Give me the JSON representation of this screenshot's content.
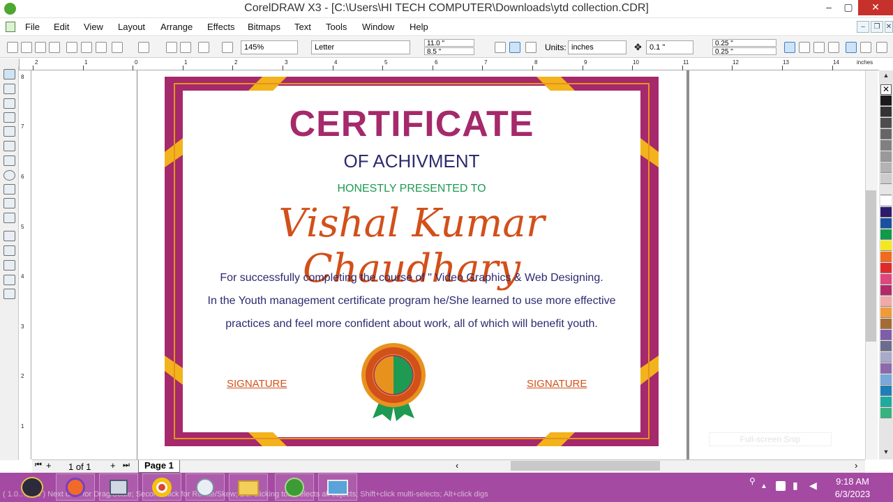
{
  "window": {
    "title": "CorelDRAW X3 - [C:\\Users\\HI TECH COMPUTER\\Downloads\\ytd collection.CDR]",
    "min": "–",
    "max": "▢",
    "close": "✕"
  },
  "menu": [
    "File",
    "Edit",
    "View",
    "Layout",
    "Arrange",
    "Effects",
    "Bitmaps",
    "Text",
    "Tools",
    "Window",
    "Help"
  ],
  "toolbar": {
    "zoom": "145%",
    "paper": "Letter",
    "width": "11.0 \"",
    "height": "8.5 \"",
    "units_label": "Units:",
    "units": "inches",
    "nudge": "0.1 \"",
    "dup_x": "0.25 \"",
    "dup_y": "0.25 \""
  },
  "ruler": {
    "units": "inches",
    "h_labels": [
      "2",
      "1",
      "0",
      "1",
      "2",
      "3",
      "4",
      "5",
      "6",
      "7",
      "8",
      "9",
      "10",
      "11",
      "12",
      "13",
      "14"
    ],
    "v_labels": [
      "8",
      "7",
      "6",
      "5",
      "4",
      "3",
      "2",
      "1"
    ]
  },
  "pager": {
    "count": "1 of 1",
    "tab": "Page 1"
  },
  "status": "( 1.0…,548 ) Next click for Drag/Scale; Second click for Rotate/Skew; Dbl-clicking tool selects all objects; Shift+click multi-selects; Alt+click digs",
  "snip_hint": "Full-screen Snip",
  "certificate": {
    "title": "CERTIFICATE",
    "subtitle": "OF ACHIVMENT",
    "presented": "HONESTLY PRESENTED TO",
    "name": "Vishal Kumar Chaudhary",
    "body1": "For successfully completing the course of \" Video Graphics & Web Designing.",
    "body2": "In the Youth management certificate program he/She learned to use more effective",
    "body3": "practices and feel more confident about work, all of which will benefit youth.",
    "sig_left": "SIGNATURE",
    "sig_right": "SIGNATURE"
  },
  "colors": {
    "magenta": "#a5296b",
    "gold": "#f2b31c",
    "orange_line": "#e8921e",
    "navy": "#2d2a6e",
    "green": "#1e9a52",
    "orange_name": "#d2501a",
    "taskbar": "#a44aa2"
  },
  "palette": [
    "#ffffff",
    "#1a1a1a",
    "#333333",
    "#4d4d4d",
    "#666666",
    "#808080",
    "#999999",
    "#b3b3b3",
    "#cccccc",
    "#e6e6e6",
    "#ffffff",
    "#2d1b6b",
    "#1d4fa0",
    "#0f9b4a",
    "#f3e81f",
    "#f06b1e",
    "#e02a2a",
    "#e0457c",
    "#b22a66",
    "#f0a8a8",
    "#f29a3a",
    "#a56b35",
    "#7f5ea9",
    "#6c6c8f",
    "#a9a9c8",
    "#8b6aad",
    "#7aa8d8",
    "#1e7fb8",
    "#1faa9e",
    "#36b37e"
  ],
  "clock": {
    "time": "9:18 AM",
    "date": "6/3/2023"
  }
}
